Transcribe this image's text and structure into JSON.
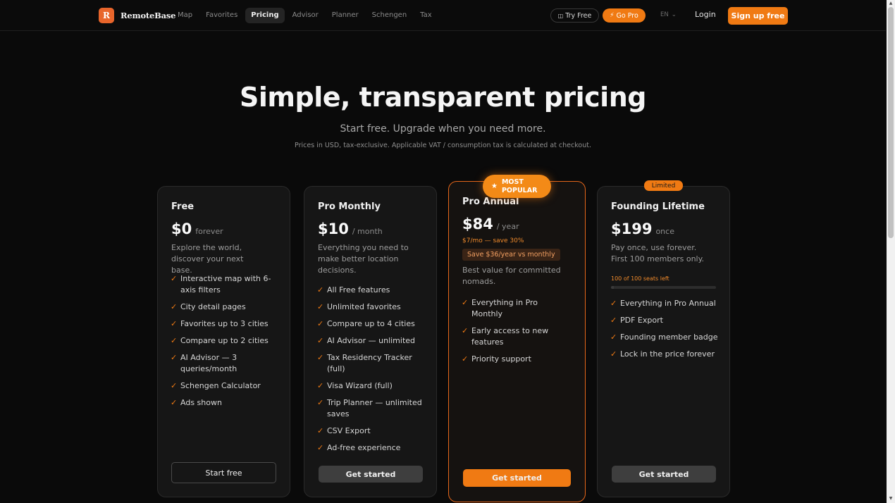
{
  "nav": {
    "logo_letter": "R",
    "brand": "RemoteBase",
    "links": [
      "Map",
      "Favorites",
      "Pricing",
      "Advisor",
      "Planner",
      "Schengen",
      "Tax"
    ],
    "active_link": "Pricing",
    "try_free": "Try Free",
    "go_pro": "Go Pro",
    "lang": "EN",
    "login": "Login",
    "signup": "Sign up free"
  },
  "hero": {
    "title": "Simple, transparent pricing",
    "subtitle": "Start free. Upgrade when you need more.",
    "note": "Prices in USD, tax-exclusive. Applicable VAT / consumption tax is calculated at checkout."
  },
  "plans": [
    {
      "name": "Free",
      "price": "$0",
      "per": "forever",
      "description": "Explore the world, discover your next base.",
      "features": [
        "Interactive map with 6-axis filters",
        "City detail pages",
        "Favorites up to 3 cities",
        "Compare up to 2 cities",
        "AI Advisor — 3 queries/month",
        "Schengen Calculator",
        "Ads shown"
      ],
      "cta": "Start free"
    },
    {
      "name": "Pro Monthly",
      "price": "$10",
      "per": "/ month",
      "description": "Everything you need to make better location decisions.",
      "features": [
        "All Free features",
        "Unlimited favorites",
        "Compare up to 4 cities",
        "AI Advisor — unlimited",
        "Tax Residency Tracker (full)",
        "Visa Wizard (full)",
        "Trip Planner — unlimited saves",
        "CSV Export",
        "Ad-free experience"
      ],
      "cta": "Get started"
    },
    {
      "name": "Pro Annual",
      "badge": "MOST POPULAR",
      "price": "$84",
      "per": "/ year",
      "monthly_equiv": "$7/mo — save 30%",
      "save_pill": "Save $36/year vs monthly",
      "description": "Best value for committed nomads.",
      "features": [
        "Everything in Pro Monthly",
        "Early access to new features",
        "Priority support"
      ],
      "cta": "Get started"
    },
    {
      "name": "Founding Lifetime",
      "badge": "Limited",
      "price": "$199",
      "per": "once",
      "description": "Pay once, use forever. First 100 members only.",
      "seats_text": "100 of 100 seats left",
      "seats_claimed_fraction": 0.03,
      "features": [
        "Everything in Pro Annual",
        "PDF Export",
        "Founding member badge",
        "Lock in the price forever"
      ],
      "cta": "Get started"
    }
  ],
  "colors": {
    "accent": "#f07a13",
    "background": "#0a0a0a",
    "card": "#161616"
  }
}
